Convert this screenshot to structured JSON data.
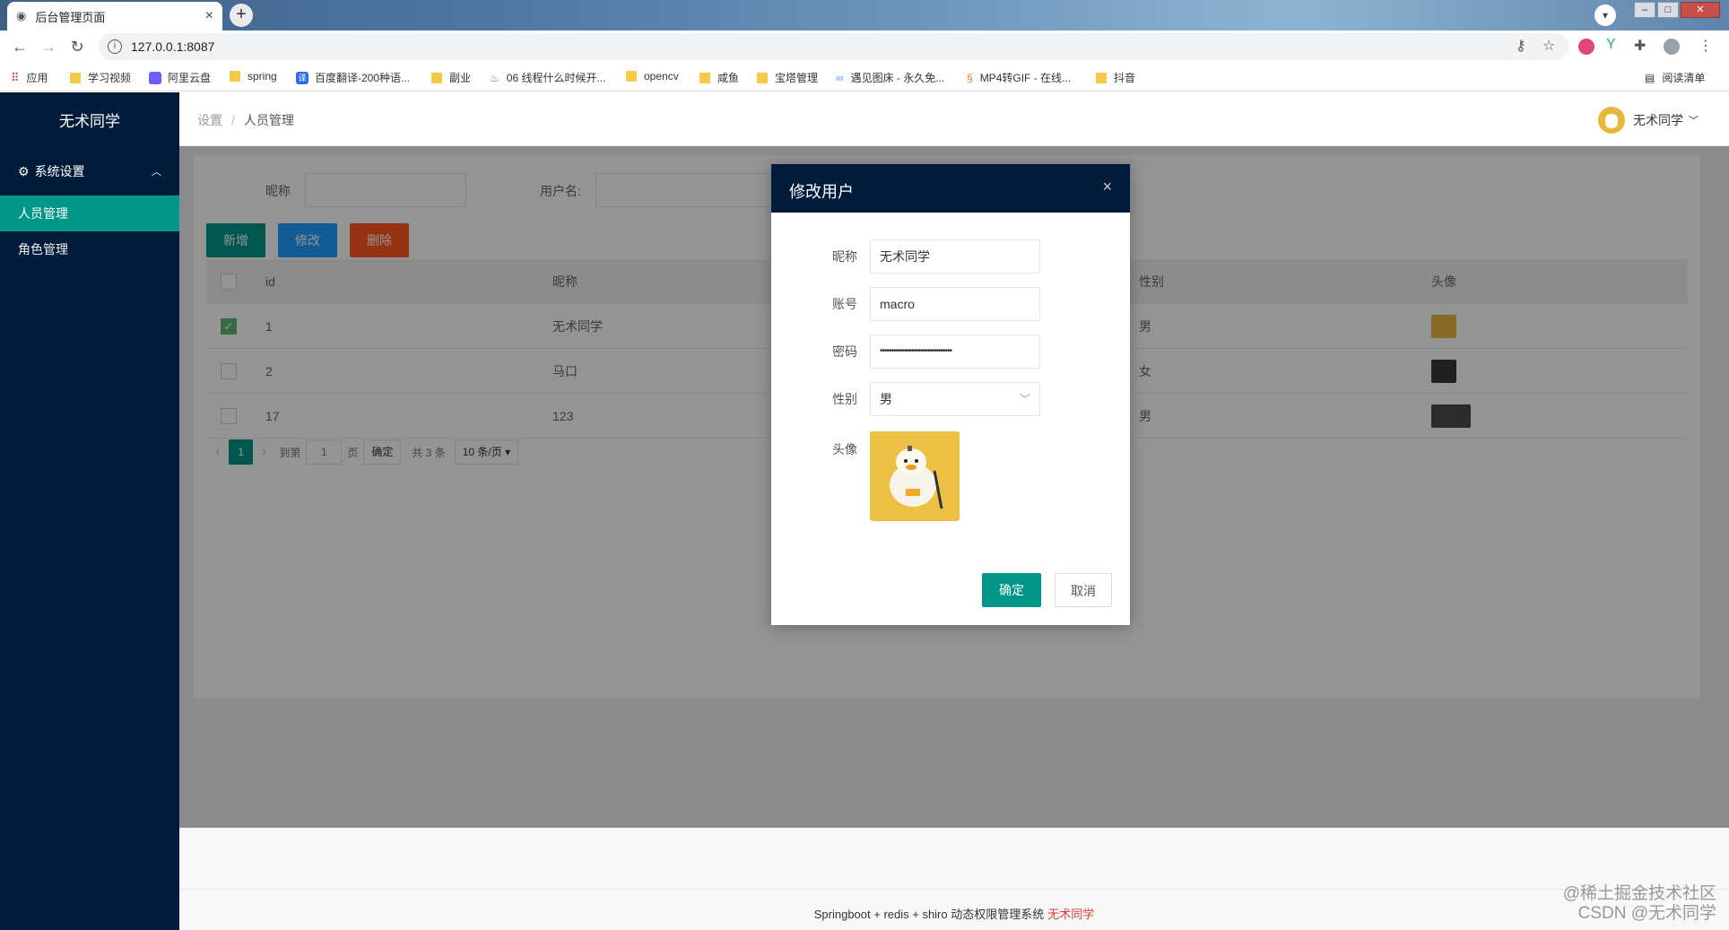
{
  "browser": {
    "tab_title": "后台管理页面",
    "tab_close": "×",
    "new_tab": "+",
    "url": "127.0.0.1:8087",
    "bookmarks": [
      "应用",
      "学习视频",
      "阿里云盘",
      "spring",
      "百度翻译-200种语...",
      "副业",
      "06 线程什么时候开...",
      "opencv",
      "咸鱼",
      "宝塔管理",
      "遇见图床 - 永久免...",
      "MP4转GIF - 在线...",
      "抖音"
    ],
    "reading_list": "阅读清单"
  },
  "sidebar": {
    "logo": "无术同学",
    "group": "系统设置",
    "items": [
      "人员管理",
      "角色管理"
    ]
  },
  "header": {
    "breadcrumb": [
      "设置",
      "人员管理"
    ],
    "separator": "/",
    "user": "无术同学"
  },
  "search": {
    "nickname_label": "昵称",
    "username_label": "用户名:"
  },
  "actions": {
    "add": "新增",
    "edit": "修改",
    "delete": "删除"
  },
  "table": {
    "headers": [
      "id",
      "昵称",
      "性别",
      "头像"
    ],
    "rows": [
      {
        "id": "1",
        "nickname": "无术同学",
        "gender": "男",
        "checked": true
      },
      {
        "id": "2",
        "nickname": "马口",
        "gender": "女",
        "checked": false
      },
      {
        "id": "17",
        "nickname": "123",
        "gender": "男",
        "checked": false
      }
    ]
  },
  "pager": {
    "prev": "‹",
    "current": "1",
    "next": "›",
    "goto": "到第",
    "page_input": "1",
    "page_unit": "页",
    "ok": "确定",
    "total": "共 3 条",
    "size": "10 条/页"
  },
  "modal": {
    "title": "修改用户",
    "close": "×",
    "fields": {
      "nickname_label": "昵称",
      "nickname_value": "无术同学",
      "account_label": "账号",
      "account_value": "macro",
      "password_label": "密码",
      "password_value": "••••••••••••••••••••••••••••••••",
      "gender_label": "性别",
      "gender_value": "男",
      "avatar_label": "头像"
    },
    "confirm": "确定",
    "cancel": "取消"
  },
  "footer": {
    "text": "Springboot + redis + shiro 动态权限管理系统",
    "highlight": "无术同学"
  },
  "watermark": [
    "@稀土掘金技术社区",
    "CSDN @无术同学"
  ],
  "colors": {
    "teal": "#009688",
    "blue": "#1e9fff",
    "orange": "#ff5722",
    "navy": "#011b3a"
  }
}
